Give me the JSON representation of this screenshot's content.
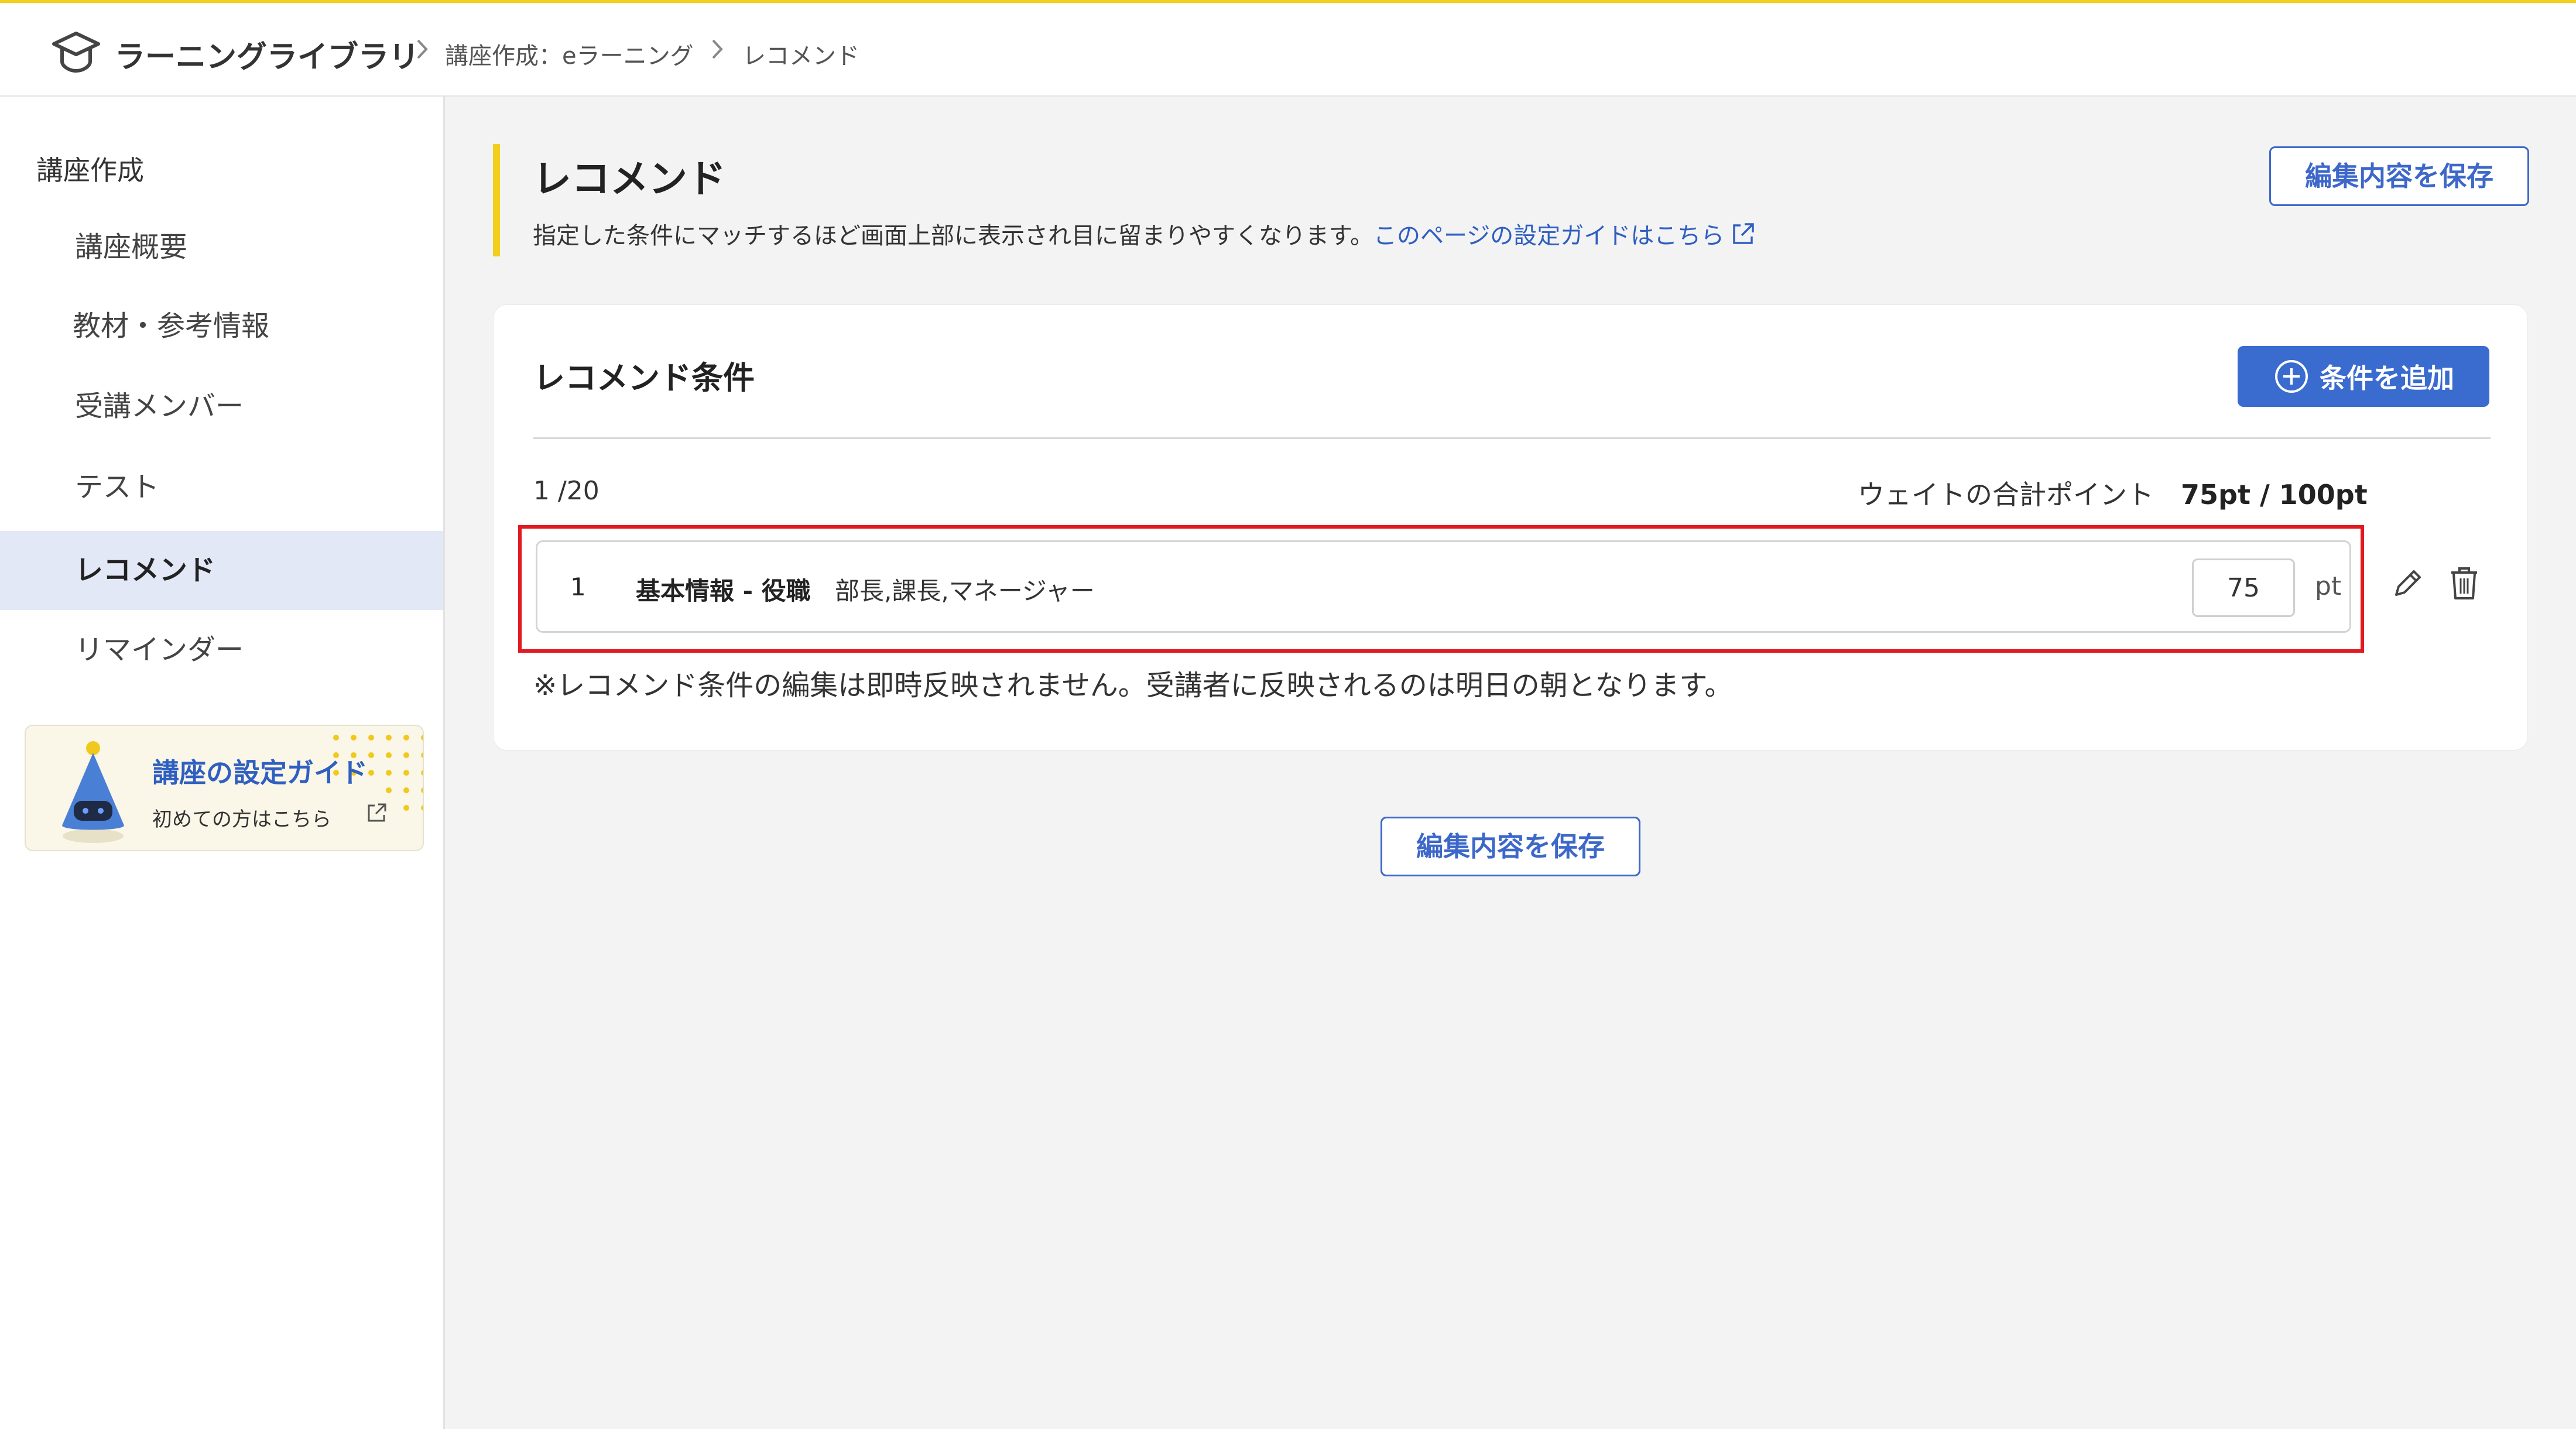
{
  "topbar": {
    "app_title": "ラーニングライブラリ",
    "breadcrumb": [
      "講座作成：eラーニング",
      "レコメンド"
    ]
  },
  "sidebar": {
    "section_label": "講座作成",
    "items": [
      {
        "label": "講座概要"
      },
      {
        "label": "教材・参考情報"
      },
      {
        "label": "受講メンバー"
      },
      {
        "label": "テスト"
      },
      {
        "label": "レコメンド",
        "active": true
      },
      {
        "label": "リマインダー"
      }
    ],
    "guide_card": {
      "title": "講座の設定ガイド",
      "subtitle": "初めての方はこちら"
    }
  },
  "header": {
    "title": "レコメンド",
    "description": "指定した条件にマッチするほど画面上部に表示され目に留まりやすくなります。",
    "guide_link": "このページの設定ガイドはこちら",
    "save_label": "編集内容を保存"
  },
  "recommend": {
    "title": "レコメンド条件",
    "add_label": "条件を追加",
    "count": "1 /20",
    "weight_total_label": "ウェイトの合計ポイント",
    "weight_total_value": "75pt / 100pt",
    "conditions": [
      {
        "number": "1",
        "name": "基本情報 - 役職",
        "values": "部長,課長,マネージャー",
        "weight": "75",
        "unit": "pt"
      }
    ],
    "note": "※レコメンド条件の編集は即時反映されません。受講者に反映されるのは明日の朝となります。"
  },
  "footer": {
    "save_label": "編集内容を保存"
  },
  "colors": {
    "accent": "#3a6bcf",
    "highlight_border": "#e11a22",
    "header_bar": "#f2cf1f",
    "active_item_bg": "#e3e8f6"
  }
}
